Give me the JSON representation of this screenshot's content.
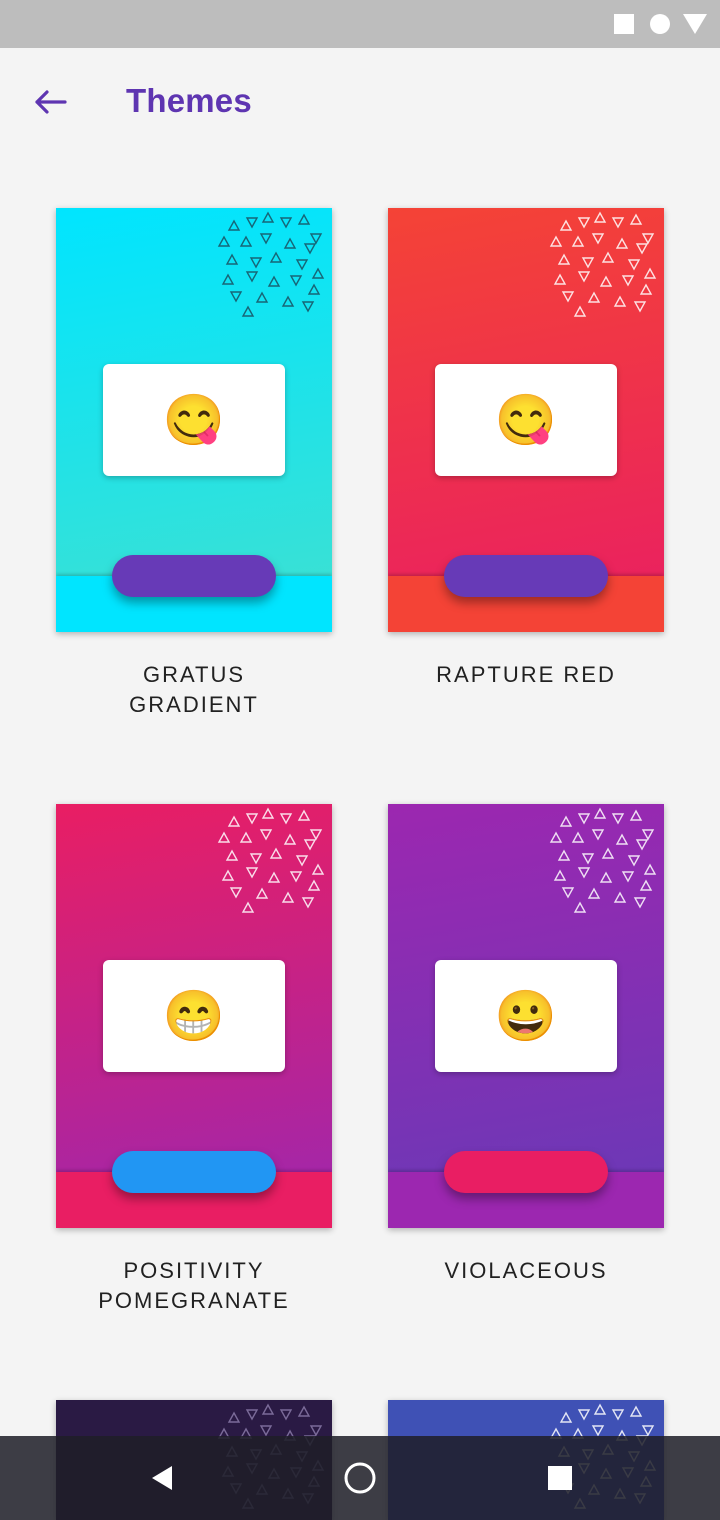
{
  "header": {
    "title": "Themes"
  },
  "themes": [
    {
      "name": "GRATUS\nGRADIENT",
      "line1": "GRATUS",
      "line2": "GRADIENT",
      "grad_top": "#00e5ff",
      "grad_bottom": "#40e0d0",
      "strip": "#00e5ff",
      "pill": "#673ab7",
      "pattern_color": "#1a4f5f",
      "emoji": "😋"
    },
    {
      "name": "RAPTURE RED",
      "line1": "RAPTURE RED",
      "line2": "",
      "grad_top": "#f44336",
      "grad_bottom": "#e91e63",
      "strip": "#f44336",
      "pill": "#673ab7",
      "pattern_color": "#ffffff",
      "emoji": "😋"
    },
    {
      "name": "POSITIVITY\nPOMEGRANATE",
      "line1": "POSITIVITY",
      "line2": "POMEGRANATE",
      "grad_top": "#e91e63",
      "grad_bottom": "#9c27b0",
      "strip": "#e91e63",
      "pill": "#2196f3",
      "pattern_color": "#ffffff",
      "emoji": "😁"
    },
    {
      "name": "VIOLACEOUS",
      "line1": "VIOLACEOUS",
      "line2": "",
      "grad_top": "#9c27b0",
      "grad_bottom": "#673ab7",
      "strip": "#9c27b0",
      "pill": "#e91e63",
      "pattern_color": "#ffffff",
      "emoji": "😀"
    },
    {
      "grad_top": "#2a1a44",
      "grad_bottom": "#2a1a44",
      "pattern_color": "#8a7aa8"
    },
    {
      "grad_top": "#3f51b5",
      "grad_bottom": "#3f51b5",
      "pattern_color": "#ffffff"
    }
  ],
  "icons": {
    "back": "arrow-left-icon",
    "nav_back": "triangle-back-icon",
    "nav_home": "circle-home-icon",
    "nav_recents": "square-recents-icon"
  }
}
